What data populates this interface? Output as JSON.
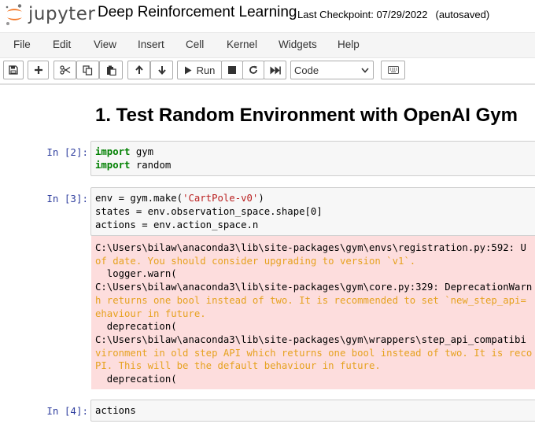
{
  "header": {
    "logo_text": "jupyter",
    "notebook_title": "Deep Reinforcement Learning",
    "checkpoint": "Last Checkpoint: 07/29/2022",
    "autosave": "(autosaved)"
  },
  "menu": [
    "File",
    "Edit",
    "View",
    "Insert",
    "Cell",
    "Kernel",
    "Widgets",
    "Help"
  ],
  "toolbar": {
    "icons": [
      "save-icon",
      "plus-icon",
      "cut-icon",
      "copy-icon",
      "paste-icon",
      "arrow-up-icon",
      "arrow-down-icon",
      "play-icon",
      "stop-icon",
      "restart-icon",
      "fast-forward-icon",
      "keyboard-icon"
    ],
    "run_label": "Run",
    "cell_type": "Code"
  },
  "cells": {
    "heading": "1. Test Random Environment with OpenAI Gym",
    "cell2": {
      "prompt": "In [2]:",
      "lines": [
        {
          "kw": "import",
          "rest": " gym"
        },
        {
          "kw": "import",
          "rest": " random"
        }
      ]
    },
    "cell3": {
      "prompt": "In [3]:",
      "line1": {
        "pre": "env = gym.make(",
        "str": "'CartPole-v0'",
        "post": ")"
      },
      "line2": "states = env.observation_space.shape[0]",
      "line3": "actions = env.action_space.n",
      "stderr": [
        {
          "text": "C:\\Users\\bilaw\\anaconda3\\lib\\site-packages\\gym\\envs\\registration.py:592: U",
          "style": "normal"
        },
        {
          "text": "of date. You should consider upgrading to version `v1`.",
          "style": "warn"
        },
        {
          "text": "  logger.warn(",
          "style": "normal"
        },
        {
          "text": "C:\\Users\\bilaw\\anaconda3\\lib\\site-packages\\gym\\core.py:329: DeprecationWarn",
          "style": "normal"
        },
        {
          "text": "h returns one bool instead of two. It is recommended to set `new_step_api=",
          "style": "warn"
        },
        {
          "text": "ehaviour in future.",
          "style": "warn"
        },
        {
          "text": "  deprecation(",
          "style": "normal"
        },
        {
          "text": "C:\\Users\\bilaw\\anaconda3\\lib\\site-packages\\gym\\wrappers\\step_api_compatibi",
          "style": "normal"
        },
        {
          "text": "vironment in old step API which returns one bool instead of two. It is reco",
          "style": "warn"
        },
        {
          "text": "PI. This will be the default behaviour in future.",
          "style": "warn"
        },
        {
          "text": "  deprecation(",
          "style": "normal"
        }
      ]
    },
    "cell4": {
      "prompt": "In [4]:",
      "code": "actions"
    }
  }
}
